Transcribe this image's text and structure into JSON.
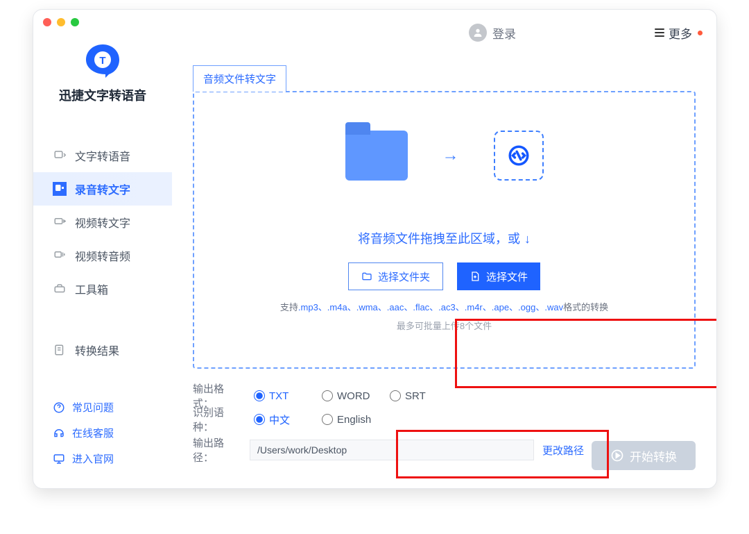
{
  "app": {
    "title": "迅捷文字转语音"
  },
  "header": {
    "login": "登录",
    "more": "更多"
  },
  "sidebar": {
    "items": [
      {
        "label": "文字转语音"
      },
      {
        "label": "录音转文字"
      },
      {
        "label": "视频转文字"
      },
      {
        "label": "视频转音频"
      },
      {
        "label": "工具箱"
      }
    ],
    "results_label": "转换结果",
    "links": {
      "faq": "常见问题",
      "support": "在线客服",
      "site": "进入官网"
    }
  },
  "main": {
    "tab": "音频文件转文字",
    "drop_hint": "将音频文件拖拽至此区域，或",
    "select_folder": "选择文件夹",
    "select_file": "选择文件",
    "formats_prefix": "支持",
    "formats": ".mp3、.m4a、.wma、.aac、.flac、.ac3、.m4r、.ape、.ogg、.wav",
    "formats_suffix": "格式的转换",
    "upload_limit": "最多可批量上传8个文件",
    "out_format_label": "输出格式：",
    "out_formats": {
      "txt": "TXT",
      "word": "WORD",
      "srt": "SRT"
    },
    "lang_label": "识别语种：",
    "langs": {
      "zh": "中文",
      "en": "English"
    },
    "path_label": "输出路径：",
    "path_value": "/Users/work/Desktop",
    "change_path": "更改路径",
    "start": "开始转换"
  }
}
